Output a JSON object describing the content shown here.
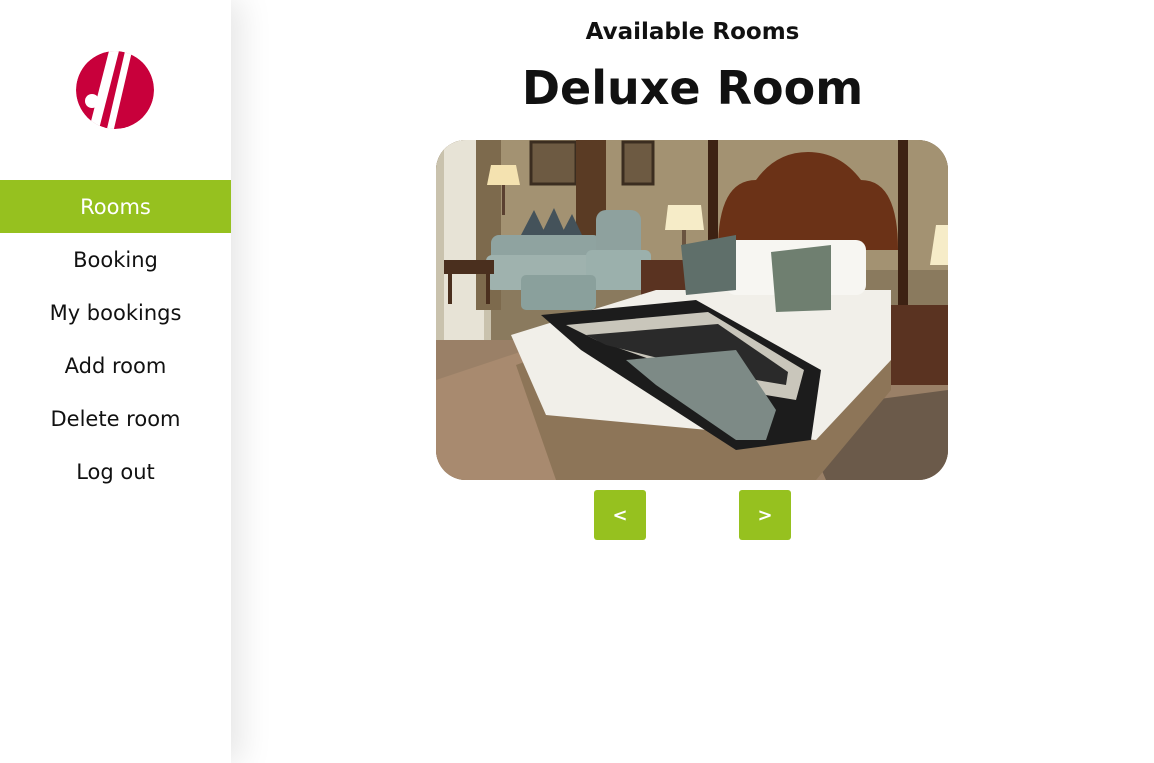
{
  "brand": {
    "logo_icon": "marriott-logo-icon",
    "color": "#c8003b"
  },
  "sidebar": {
    "items": [
      {
        "label": "Rooms",
        "active": true
      },
      {
        "label": "Booking",
        "active": false
      },
      {
        "label": "My bookings",
        "active": false
      },
      {
        "label": "Add room",
        "active": false
      },
      {
        "label": "Delete room",
        "active": false
      },
      {
        "label": "Log out",
        "active": false
      }
    ]
  },
  "main": {
    "subtitle": "Available Rooms",
    "room_name": "Deluxe Room",
    "photo_icon": "hotel-room-photo",
    "prev_label": "<",
    "next_label": ">"
  },
  "colors": {
    "accent": "#96c11f",
    "text": "#111111",
    "background": "#ffffff"
  }
}
